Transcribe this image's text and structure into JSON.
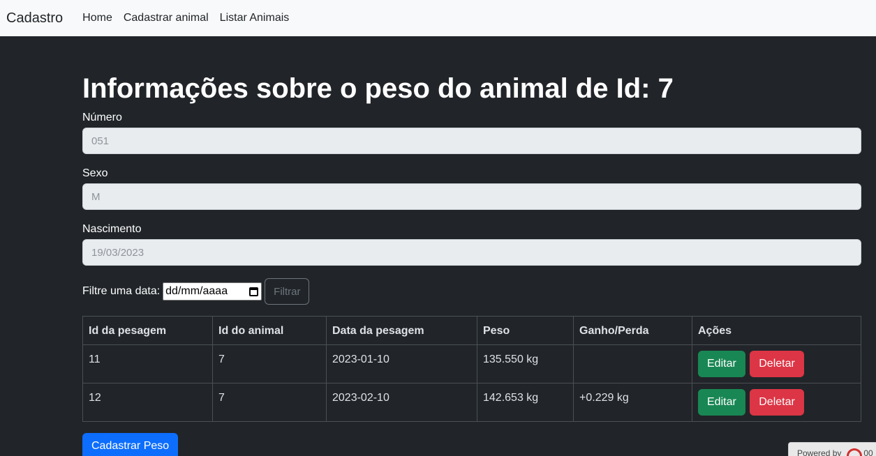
{
  "navbar": {
    "brand": "Cadastro",
    "links": [
      "Home",
      "Cadastrar animal",
      "Listar Animais"
    ]
  },
  "page": {
    "title": "Informações sobre o peso do animal de Id: 7"
  },
  "fields": {
    "numero_label": "Número",
    "numero_value": "051",
    "sexo_label": "Sexo",
    "sexo_value": "M",
    "nascimento_label": "Nascimento",
    "nascimento_value": "19/03/2023"
  },
  "filter": {
    "label": "Filtre uma data:",
    "date_placeholder": "dd/mm/aaaa",
    "button": "Filtrar"
  },
  "table": {
    "headers": [
      "Id da pesagem",
      "Id do animal",
      "Data da pesagem",
      "Peso",
      "Ganho/Perda",
      "Ações"
    ],
    "rows": [
      {
        "id": "11",
        "animal": "7",
        "data": "2023-01-10",
        "peso": "135.550 kg",
        "ganho": ""
      },
      {
        "id": "12",
        "animal": "7",
        "data": "2023-02-10",
        "peso": "142.653 kg",
        "ganho": "+0.229 kg"
      }
    ],
    "edit_label": "Editar",
    "delete_label": "Deletar"
  },
  "cadastrar_button": "Cadastrar Peso",
  "footer": {
    "powered_text": "Powered by",
    "logo_text": "00"
  },
  "colors": {
    "background": "#212529",
    "navbar": "#f8f9fa",
    "edit": "#198754",
    "delete": "#dc3545",
    "primary": "#0d6efd"
  },
  "icons": [
    "calendar-icon",
    "powered-by-logo-icon"
  ]
}
